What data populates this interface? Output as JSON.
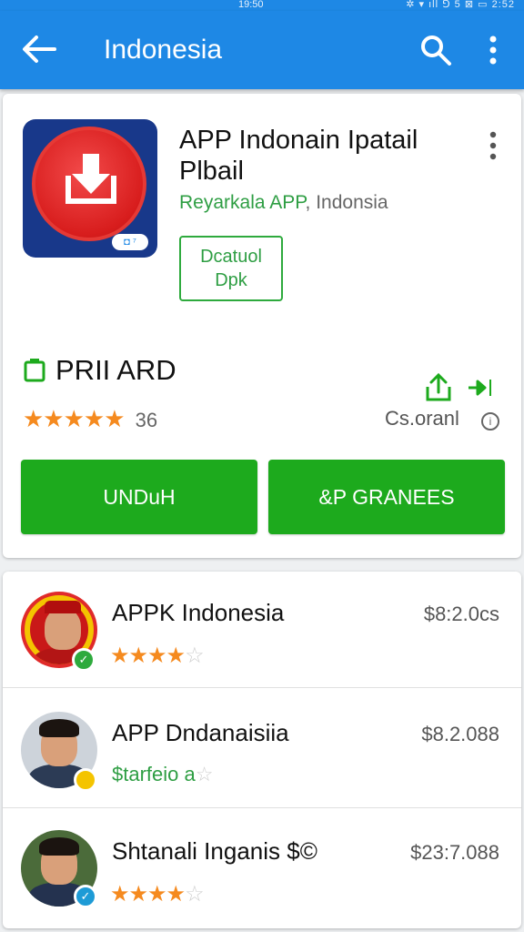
{
  "status_bar": {
    "time": "19:50",
    "icons": "✲ ▾ ıll ⅁ 5 ⊠ ▭ 2:52"
  },
  "app_bar": {
    "title": "Indonesia",
    "back_icon": "arrow-left-icon",
    "search_icon": "search-icon",
    "more_icon": "more-vert-icon",
    "color": "#1e88e5"
  },
  "app": {
    "title": "APP Indonain Ipatail Plbail",
    "developer": "Reyarkala APP",
    "developer_sep": ",",
    "developer_region": "Indonsia",
    "badge_label_1": "Dcatuol",
    "badge_label_2": "Dpk",
    "price_label": "PRII ARD",
    "stars": "★★★★★",
    "rating_count": "36",
    "download_label": "Cs.oranl",
    "install_button": "UNDuH",
    "secondary_button": "&P GRANEES",
    "icon_tag": "◘ ⁷",
    "accent_green": "#1daa1d"
  },
  "list": {
    "items": [
      {
        "name": "APPK Indonesia",
        "stars": "★★★★",
        "half_star": "☆",
        "price": "$8:2.0cs",
        "badge": "✓"
      },
      {
        "name": "APP Dndanaisiia",
        "subtitle": "$tarfeio a",
        "subtitle_star": "☆",
        "price": "$8.2.088",
        "badge": ""
      },
      {
        "name": "Shtanali Inganis $©",
        "stars": "★★★★",
        "empty_star": "☆",
        "price": "$23:7.088",
        "badge": "✓"
      }
    ]
  }
}
